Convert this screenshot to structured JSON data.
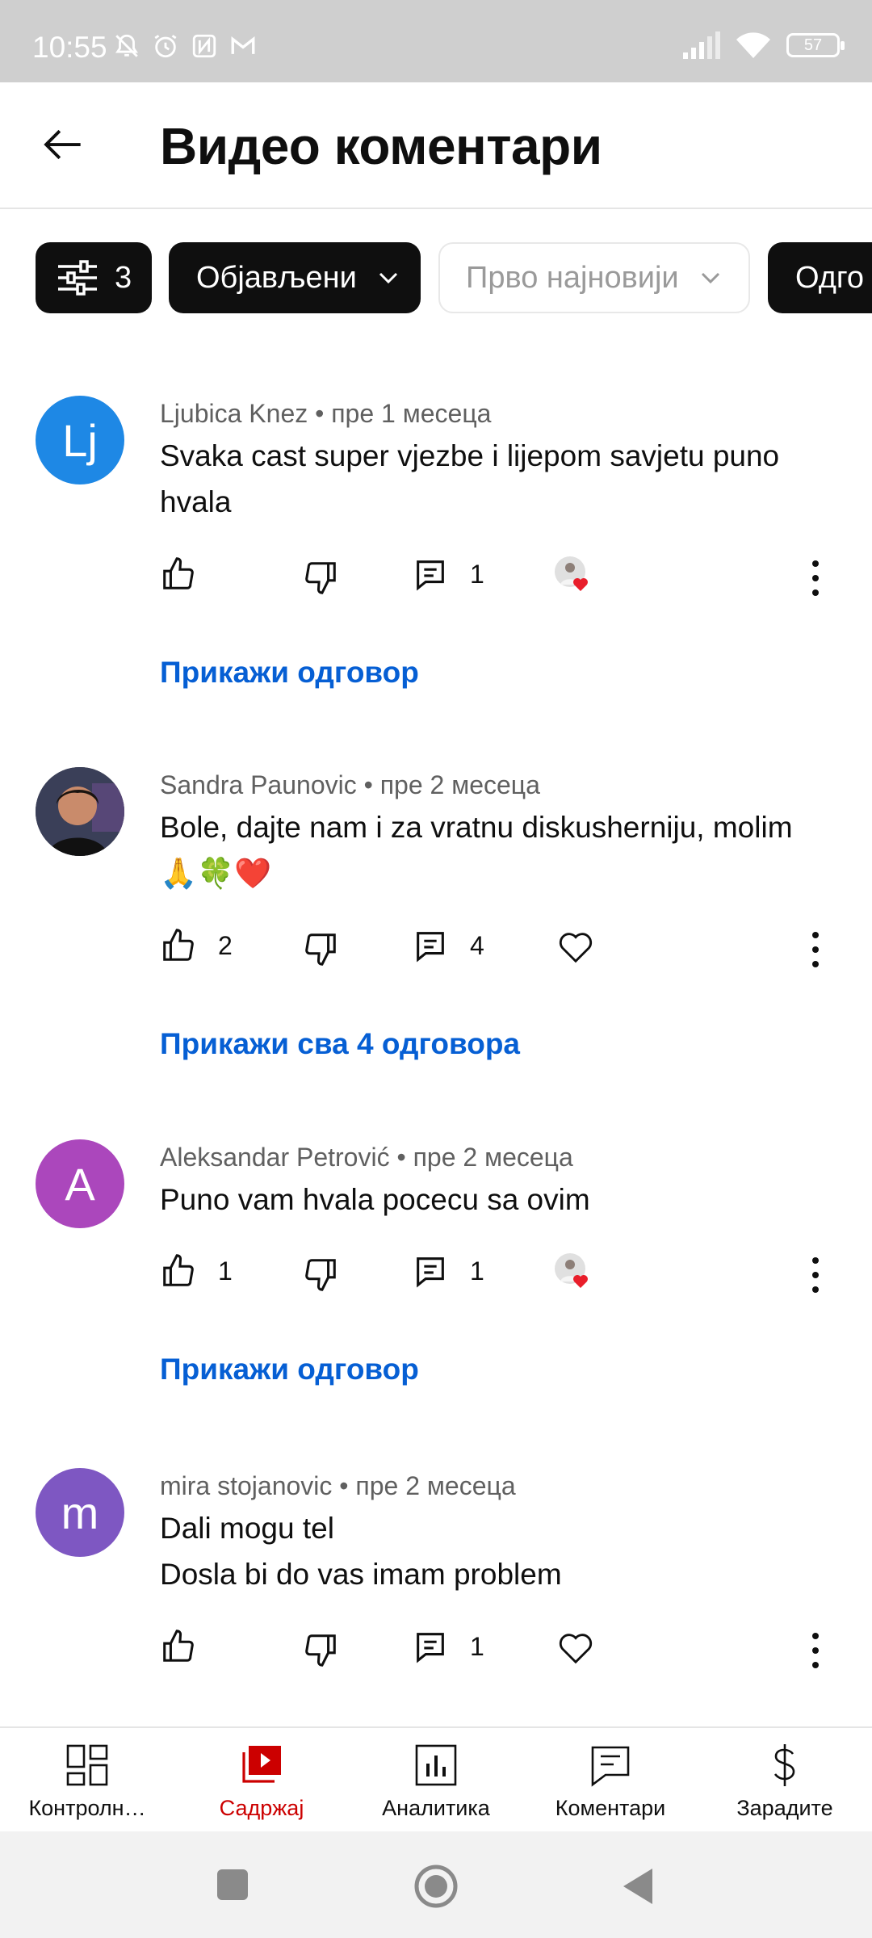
{
  "status_bar": {
    "time": "10:55",
    "battery": "57",
    "icons": [
      "notifications-muted-icon",
      "alarm-icon",
      "nfc-icon",
      "gmail-icon",
      "signal-icon",
      "wifi-icon",
      "battery-icon"
    ]
  },
  "header": {
    "title": "Видео коментари"
  },
  "filters": {
    "filter_count": "3",
    "status_label": "Објављени",
    "sort_label": "Прво најновији",
    "next_chip_label": "Одго"
  },
  "comments": [
    {
      "author": "Ljubica Knez",
      "separator": "•",
      "time": "пре 1 месеца",
      "text": "Svaka cast super vjezbe i lijepom savjetu puno hvala",
      "avatar_letter": "Lj",
      "avatar_color": "#1e88e5",
      "likes": "",
      "replies": "1",
      "creator_hearted": true,
      "reply_link": "Прикажи одговор"
    },
    {
      "author": "Sandra Paunovic",
      "separator": "•",
      "time": "пре 2 месеца",
      "text": "Bole, dajte nam i za vratnu diskusherniju, molim 🙏🍀❤️",
      "avatar_letter": "",
      "avatar_color": "#2b2b33",
      "likes": "2",
      "replies": "4",
      "creator_hearted": false,
      "reply_link": "Прикажи сва 4 одговора"
    },
    {
      "author": "Aleksandar Petrović",
      "separator": "•",
      "time": "пре 2 месеца",
      "text": "Puno vam hvala pocecu sa ovim",
      "avatar_letter": "A",
      "avatar_color": "#ab47bc",
      "likes": "1",
      "replies": "1",
      "creator_hearted": true,
      "reply_link": "Прикажи одговор"
    },
    {
      "author": "mira stojanovic",
      "separator": "•",
      "time": "пре 2 месеца",
      "text": "Dali mogu tel\nDosla bi do vas imam problem",
      "avatar_letter": "m",
      "avatar_color": "#7e57c2",
      "likes": "",
      "replies": "1",
      "creator_hearted": false,
      "reply_link": ""
    }
  ],
  "bottom_nav": {
    "items": [
      {
        "label": "Контролн…",
        "icon": "dashboard-icon"
      },
      {
        "label": "Садржај",
        "icon": "content-icon"
      },
      {
        "label": "Аналитика",
        "icon": "analytics-icon"
      },
      {
        "label": "Коментари",
        "icon": "comments-icon"
      },
      {
        "label": "Зарадите",
        "icon": "earn-icon"
      }
    ],
    "active_color": "#cc0000"
  },
  "system_nav": {
    "icons": [
      "recents-icon",
      "home-icon",
      "back-icon"
    ]
  }
}
